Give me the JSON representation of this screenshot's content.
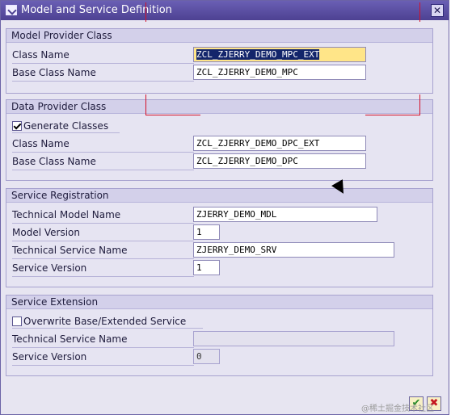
{
  "window": {
    "title": "Model and Service Definition"
  },
  "groups": {
    "mpc": {
      "title": "Model Provider Class",
      "class_name_label": "Class Name",
      "class_name_value": "ZCL_ZJERRY_DEMO_MPC_EXT",
      "base_class_label": "Base Class Name",
      "base_class_value": "ZCL_ZJERRY_DEMO_MPC"
    },
    "dpc": {
      "title": "Data Provider Class",
      "generate_label": "Generate Classes",
      "generate_checked": true,
      "class_name_label": "Class Name",
      "class_name_value": "ZCL_ZJERRY_DEMO_DPC_EXT",
      "base_class_label": "Base Class Name",
      "base_class_value": "ZCL_ZJERRY_DEMO_DPC"
    },
    "registration": {
      "title": "Service Registration",
      "tech_model_label": "Technical Model Name",
      "tech_model_value": "ZJERRY_DEMO_MDL",
      "model_version_label": "Model Version",
      "model_version_value": "1",
      "tech_service_label": "Technical Service Name",
      "tech_service_value": "ZJERRY_DEMO_SRV",
      "service_version_label": "Service Version",
      "service_version_value": "1"
    },
    "extension": {
      "title": "Service Extension",
      "overwrite_label": "Overwrite Base/Extended Service",
      "overwrite_checked": false,
      "tech_service_label": "Technical Service Name",
      "tech_service_value": "",
      "service_version_label": "Service Version",
      "service_version_value": "0"
    }
  },
  "footer": {
    "ok_icon": "checkmark-icon",
    "cancel_icon": "x-icon"
  },
  "watermark": "@稀土掘金技术社区"
}
